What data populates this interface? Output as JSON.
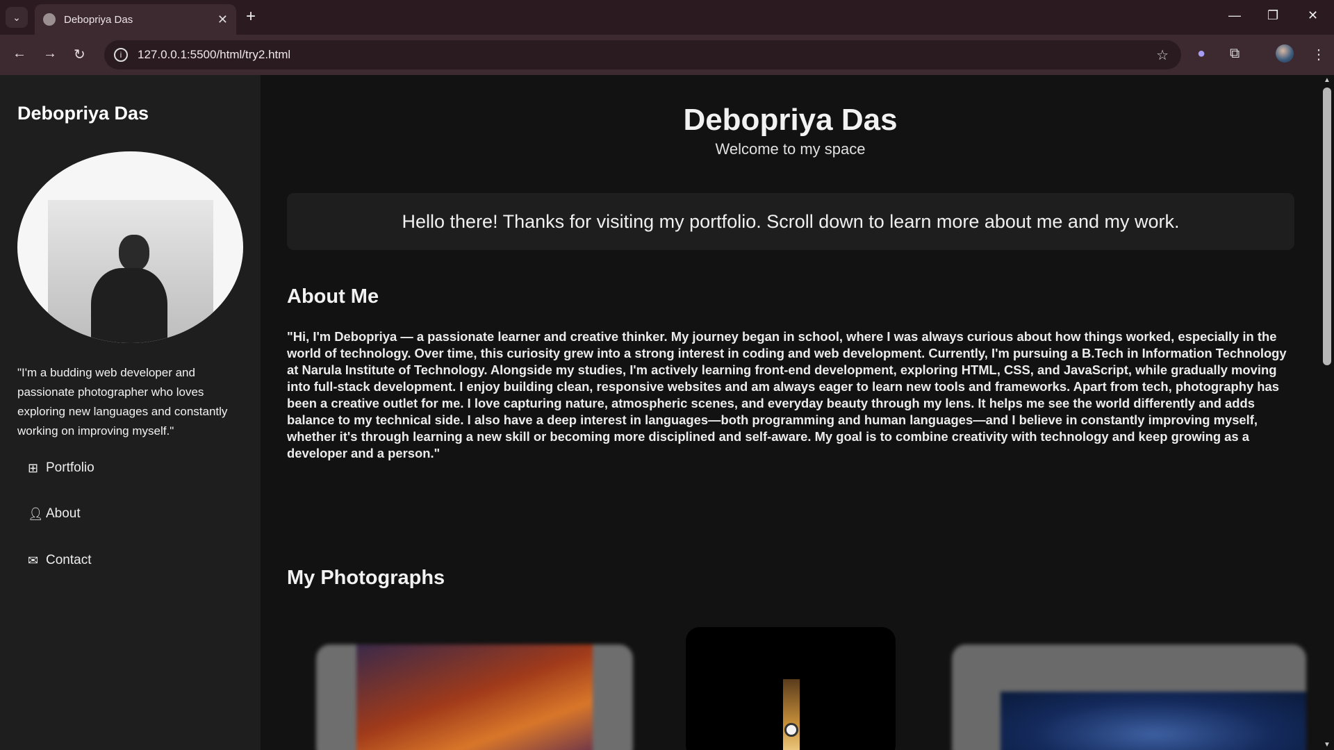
{
  "browser": {
    "tab_title": "Debopriya Das",
    "url": "127.0.0.1:5500/html/try2.html"
  },
  "sidebar": {
    "name": "Debopriya Das",
    "bio": "\"I'm a budding web developer and passionate photographer who loves exploring new languages and constantly working on improving myself.\"",
    "nav": [
      {
        "label": "Portfolio",
        "icon": "grid-icon"
      },
      {
        "label": "About",
        "icon": "user-icon"
      },
      {
        "label": "Contact",
        "icon": "envelope-icon"
      }
    ]
  },
  "main": {
    "title": "Debopriya Das",
    "subtitle": "Welcome to my space",
    "banner": "Hello there! Thanks for visiting my portfolio. Scroll down to learn more about me and my work.",
    "about_heading": "About Me",
    "about_text": "\"Hi, I'm Debopriya — a passionate learner and creative thinker. My journey began in school, where I was always curious about how things worked, especially in the world of technology. Over time, this curiosity grew into a strong interest in coding and web development. Currently, I'm pursuing a B.Tech in Information Technology at Narula Institute of Technology. Alongside my studies, I'm actively learning front-end development, exploring HTML, CSS, and JavaScript, while gradually moving into full-stack development. I enjoy building clean, responsive websites and am always eager to learn new tools and frameworks. Apart from tech, photography has been a creative outlet for me. I love capturing nature, atmospheric scenes, and everyday beauty through my lens. It helps me see the world differently and adds balance to my technical side. I also have a deep interest in languages—both programming and human languages—and I believe in constantly improving myself, whether it's through learning a new skill or becoming more disciplined and self-aware. My goal is to combine creativity with technology and keep growing as a developer and a person.\"",
    "photos_heading": "My Photographs"
  },
  "colors": {
    "page_bg": "#121212",
    "sidebar_bg": "#1e1e1e",
    "chrome_bg": "#3d2a30"
  }
}
